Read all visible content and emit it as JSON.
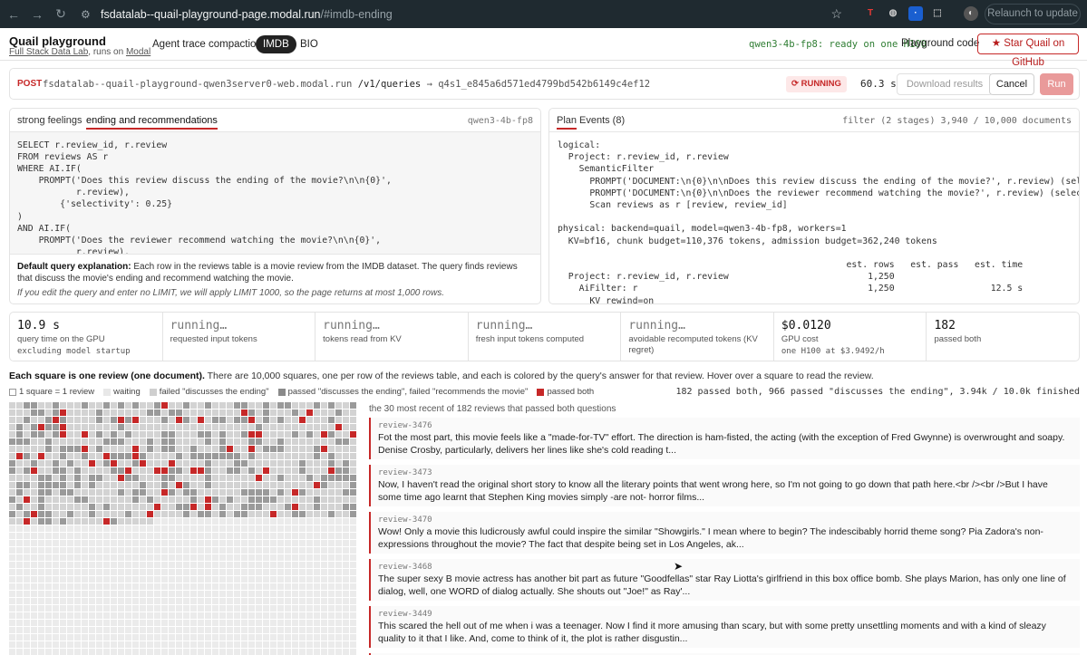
{
  "browser": {
    "url_host": "fsdatalab--quail-playground-page.modal.run",
    "url_rest": "/#imdb-ending",
    "relaunch_label": "Relaunch to update"
  },
  "header": {
    "title": "Quail playground",
    "subtitle_link1": "Full Stack Data Lab",
    "subtitle_mid": ", runs on ",
    "subtitle_link2": "Modal",
    "tabs": [
      {
        "label": "Agent trace compaction"
      },
      {
        "label": "IMDB"
      },
      {
        "label": "BIO"
      }
    ],
    "model_status": "qwen3-4b-fp8: ready on one H100",
    "playground_code": "Playground code",
    "star_github": "★ Star Quail on GitHub"
  },
  "request": {
    "method": "POST",
    "host": "fsdatalab--quail-playground-qwen3server0-web.modal.run",
    "path": "/v1/queries",
    "arrow_id": "→ q4s1_e845a6d571ed4799bd542b6149c4ef12",
    "status": "⟳ RUNNING",
    "elapsed": "60.3 s",
    "download_label": "Download results",
    "cancel_label": "Cancel",
    "run_label": "Run"
  },
  "query": {
    "tabs": [
      {
        "label": "strong feelings"
      },
      {
        "label": "ending and recommendations"
      }
    ],
    "model": "qwen3-4b-fp8",
    "sql": "SELECT r.review_id, r.review\nFROM reviews AS r\nWHERE AI.IF(\n    PROMPT('Does this review discuss the ending of the movie?\\n\\n{0}',\n           r.review),\n        {'selectivity': 0.25}\n)\nAND AI.IF(\n    PROMPT('Does the reviewer recommend watching the movie?\\n\\n{0}',\n           r.review),",
    "explanation_title": "Default query explanation:",
    "explanation_a": " Each row in the reviews table is a movie review from the ",
    "explanation_link": "IMDB dataset",
    "explanation_b": ". The query finds reviews that discuss the movie's ending and recommend watching the movie.",
    "note": "If you edit the query and enter no LIMIT, we will apply LIMIT 1000, so the page returns at most 1,000 rows."
  },
  "plan": {
    "tabs": [
      {
        "label": "Plan"
      },
      {
        "label": "Events (8)"
      }
    ],
    "summary": "filter (2 stages) 3,940 / 10,000 documents",
    "text": "logical:\n  Project: r.review_id, r.review\n    SemanticFilter\n      PROMPT('DOCUMENT:\\n{0}\\n\\nDoes this review discuss the ending of the movie?', r.review) (selectivity=25%)\n      PROMPT('DOCUMENT:\\n{0}\\n\\nDoes the reviewer recommend watching the movie?', r.review) (selectivity=50%)\n      Scan reviews as r [review, review_id]\n\nphysical: backend=quail, model=qwen3-4b-fp8, workers=1\n  KV=bf16, chunk budget=110,376 tokens, admission budget=362,240 tokens\n\n                                                      est. rows   est. pass   est. time\n  Project: r.review_id, r.review                          1,250\n    AiFilter: r                                           1,250                  12.5 s\n      KV rewind=on"
  },
  "stats": [
    {
      "value": "10.9 s",
      "label": "query time on the GPU",
      "sub": "excluding model startup"
    },
    {
      "value": "running…",
      "label": "requested input tokens",
      "sub": ""
    },
    {
      "value": "running…",
      "label": "tokens read from KV",
      "sub": ""
    },
    {
      "value": "running…",
      "label": "fresh input tokens computed",
      "sub": ""
    },
    {
      "value": "running…",
      "label": "avoidable recomputed tokens (KV regret)",
      "sub": ""
    },
    {
      "value": "$0.0120",
      "label": "GPU cost",
      "sub": "one H100 at $3.9492/h"
    },
    {
      "value": "182",
      "label": "passed both",
      "sub": ""
    }
  ],
  "grid": {
    "desc_bold": "Each square is one review (one document).",
    "desc_rest": " There are 10,000 squares, one per row of the reviews table, and each is colored by the query's answer for that review. Hover over a square to read the review.",
    "legend": [
      {
        "label": "1 square = 1 review",
        "color": "#ffffff"
      },
      {
        "label": "waiting",
        "color": "#e8e8e8"
      },
      {
        "label": "failed \"discusses the ending\"",
        "color": "#cfcfcf"
      },
      {
        "label": "passed \"discusses the ending\", failed \"recommends the movie\"",
        "color": "#8a8a8a"
      },
      {
        "label": "passed both",
        "color": "#c62828"
      }
    ],
    "progress": "182 passed both, 966 passed \"discusses the ending\", 3.94k / 10.0k finished",
    "colors": {
      "waiting": "#ebebeb",
      "failed": "#d3d3d3",
      "partial": "#9a9a9a",
      "passed": "#c62828"
    }
  },
  "reviews": {
    "caption": "the 30 most recent of 182 reviews that passed both questions",
    "items": [
      {
        "id": "review-3476",
        "text": "Fot the most part, this movie feels like a \"made-for-TV\" effort. The direction is ham-fisted, the acting (with the exception of Fred Gwynne) is overwrought and soapy. Denise Crosby, particularly, delivers her lines like she's cold reading t..."
      },
      {
        "id": "review-3473",
        "text": "Now, I haven't read the original short story to know all the literary points that went wrong here, so I'm not going to go down that path here.<br /><br />But I have some time ago learnt that Stephen King movies simply -are not- horror films..."
      },
      {
        "id": "review-3470",
        "text": "Wow! Only a movie this ludicrously awful could inspire the similar \"Showgirls.\" I mean where to begin? The indescibably horrid theme song? Pia Zadora's non-expressions throughout the movie? The fact that despite being set in Los Angeles, ak..."
      },
      {
        "id": "review-3468",
        "text": "The super sexy B movie actress has another bit part as future \"Goodfellas\" star Ray Liotta's girlfriend in this box office bomb. She plays Marion, has only one line of dialog, well, one WORD of dialog actually. She shouts out \"Joe!\" as Ray'..."
      },
      {
        "id": "review-3449",
        "text": "This scared the hell out of me when i was a teenager. Now I find it more amusing than scary, but with some pretty unsettling moments and with a kind of sleazy quality to it that I like. And, come to think of it, the plot is rather disgustin..."
      },
      {
        "id": "review-3439",
        "text": ""
      }
    ]
  }
}
